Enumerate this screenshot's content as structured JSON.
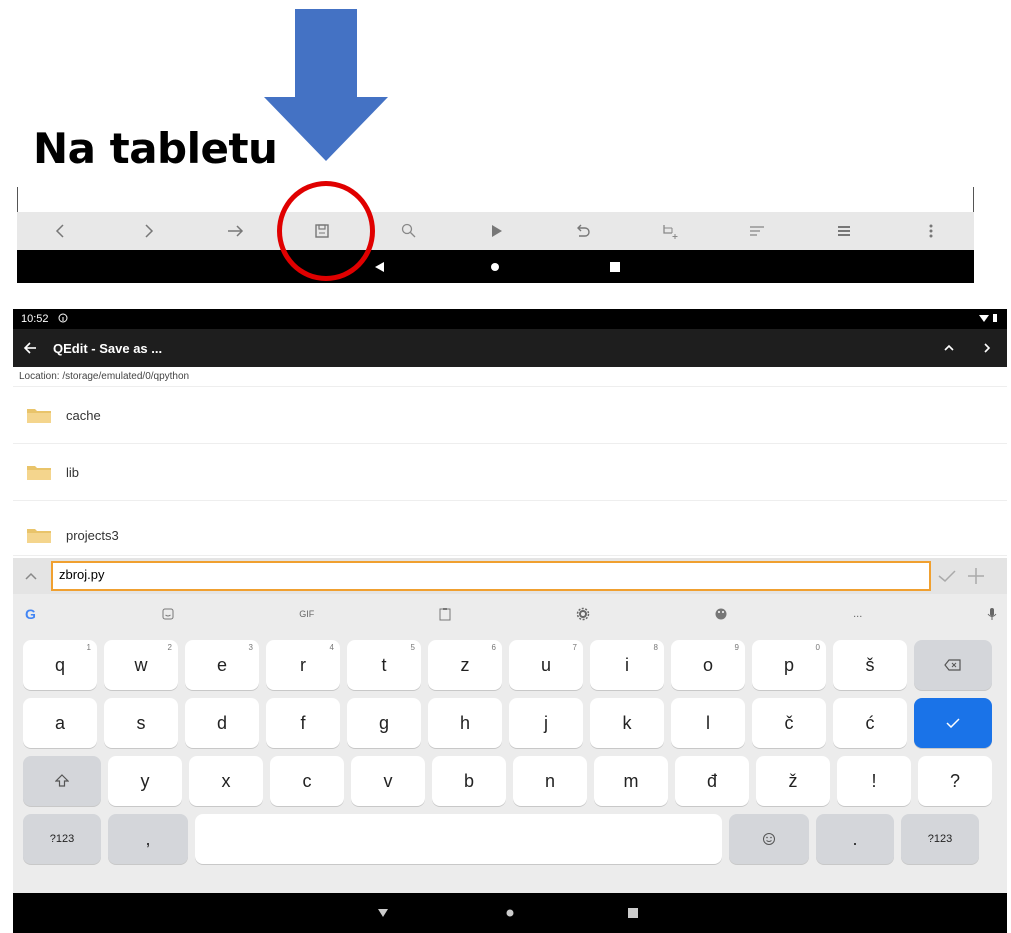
{
  "heading": "Na tabletu",
  "colors": {
    "arrow": "#4472c4",
    "highlight": "#e00000",
    "enter_key": "#1a73e8",
    "input_border": "#f0a030"
  },
  "editor_toolbar": {
    "icons": [
      "chevron-left-icon",
      "chevron-right-icon",
      "arrow-right-icon",
      "save-icon",
      "search-icon",
      "play-icon",
      "undo-icon",
      "crop-add-icon",
      "format-lines-icon",
      "menu-list-icon",
      "more-vert-icon"
    ]
  },
  "status_bar": {
    "time": "10:52"
  },
  "app_bar": {
    "title": "QEdit - Save as ..."
  },
  "location": "Location: /storage/emulated/0/qpython",
  "folders": [
    "cache",
    "lib",
    "projects3"
  ],
  "filename_input": {
    "value": "zbroj.py"
  },
  "keyboard": {
    "suggestion_bar": {
      "gif_label": "GIF",
      "more_label": "..."
    },
    "row1": [
      [
        "q",
        "1"
      ],
      [
        "w",
        "2"
      ],
      [
        "e",
        "3"
      ],
      [
        "r",
        "4"
      ],
      [
        "t",
        "5"
      ],
      [
        "z",
        "6"
      ],
      [
        "u",
        "7"
      ],
      [
        "i",
        "8"
      ],
      [
        "o",
        "9"
      ],
      [
        "p",
        "0"
      ],
      [
        "š",
        ""
      ]
    ],
    "row2": [
      "a",
      "s",
      "d",
      "f",
      "g",
      "h",
      "j",
      "k",
      "l",
      "č",
      "ć"
    ],
    "row3": [
      "y",
      "x",
      "c",
      "v",
      "b",
      "n",
      "m",
      "đ",
      "ž",
      "!",
      "?"
    ],
    "row4": {
      "left_symbols": "?123",
      "comma": ",",
      "period": ".",
      "right_symbols": "?123"
    }
  }
}
